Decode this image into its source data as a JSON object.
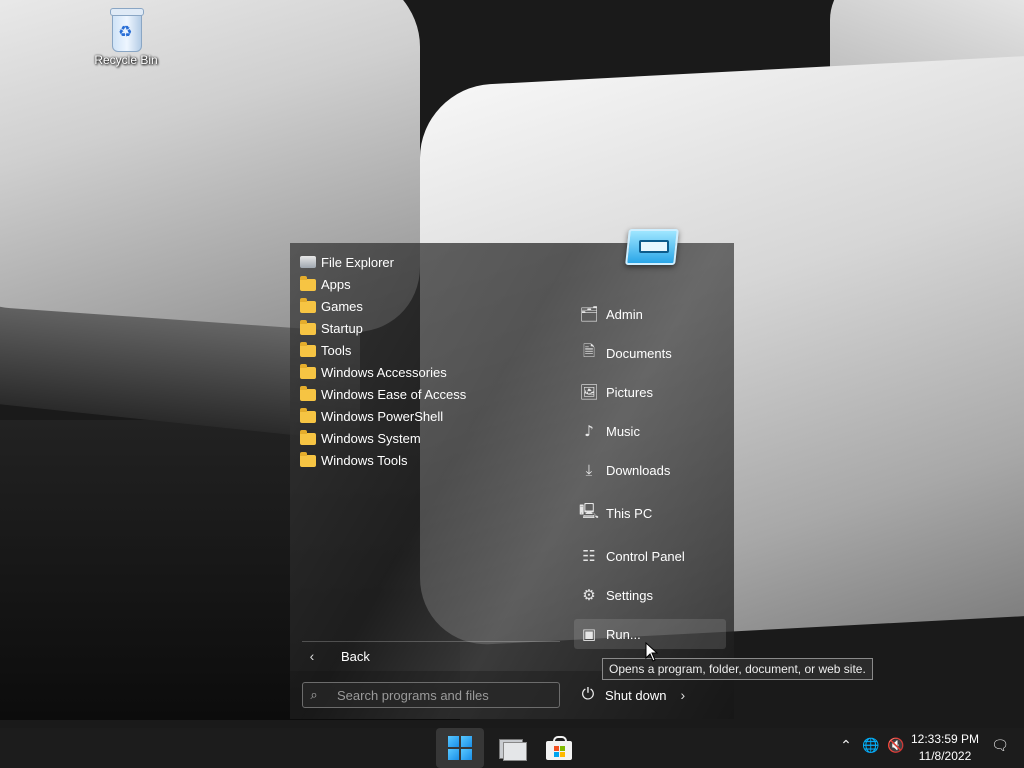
{
  "desktop": {
    "icons": [
      {
        "label": "Recycle Bin",
        "icon": "recycle-bin-icon"
      }
    ]
  },
  "start_menu": {
    "programs": [
      {
        "label": "File Explorer",
        "icon": "file-explorer-icon"
      },
      {
        "label": "Apps",
        "icon": "folder-icon"
      },
      {
        "label": "Games",
        "icon": "folder-icon"
      },
      {
        "label": "Startup",
        "icon": "folder-icon"
      },
      {
        "label": "Tools",
        "icon": "folder-icon"
      },
      {
        "label": "Windows Accessories",
        "icon": "folder-icon"
      },
      {
        "label": "Windows Ease of Access",
        "icon": "folder-icon"
      },
      {
        "label": "Windows PowerShell",
        "icon": "folder-icon"
      },
      {
        "label": "Windows System",
        "icon": "folder-icon"
      },
      {
        "label": "Windows Tools",
        "icon": "folder-icon"
      }
    ],
    "places": [
      {
        "label": "Admin",
        "icon": "user-folder-icon"
      },
      {
        "label": "Documents",
        "icon": "document-icon"
      },
      {
        "label": "Pictures",
        "icon": "picture-icon"
      },
      {
        "label": "Music",
        "icon": "music-note-icon"
      },
      {
        "label": "Downloads",
        "icon": "download-icon"
      },
      {
        "label": "This PC",
        "icon": "computer-icon"
      },
      {
        "label": "Control Panel",
        "icon": "control-panel-icon"
      },
      {
        "label": "Settings",
        "icon": "gear-icon"
      },
      {
        "label": "Run...",
        "icon": "run-icon"
      }
    ],
    "back_label": "Back",
    "search_placeholder": "Search programs and files",
    "shutdown_label": "Shut down",
    "tooltip": "Opens a program, folder, document, or web site."
  },
  "taskbar": {
    "buttons": [
      {
        "name": "start",
        "icon": "windows-logo-icon",
        "active": true
      },
      {
        "name": "file-explorer",
        "icon": "file-explorer-icon",
        "active": false
      },
      {
        "name": "store",
        "icon": "store-icon",
        "active": false
      }
    ],
    "clock": {
      "time": "12:33:59 PM",
      "date": "11/8/2022"
    }
  }
}
